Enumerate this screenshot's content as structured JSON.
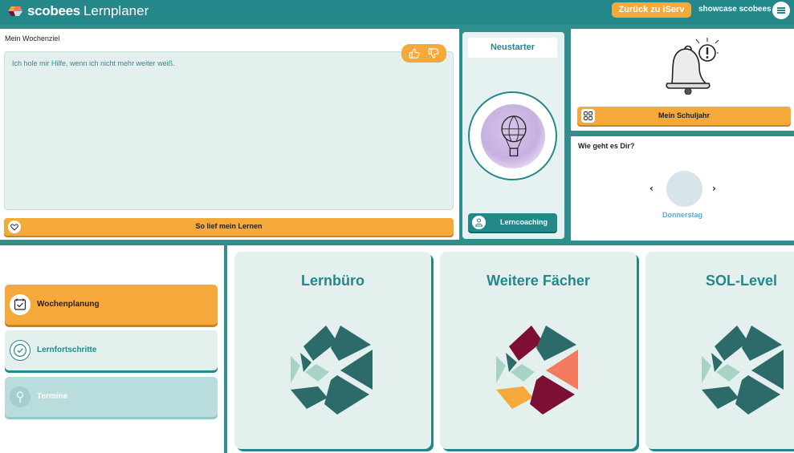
{
  "header": {
    "logo_brand": "scobees",
    "logo_sub": "Lernplaner",
    "back_button": "Zurück zu iServ",
    "user_name": "showcase scobees"
  },
  "goal": {
    "title": "Mein Wochenziel",
    "text": "Ich hole mir Hilfe, wenn ich nicht mehr weiter weiß.",
    "learn_button": "So lief mein Lernen"
  },
  "neustarter": {
    "title": "Neustarter",
    "coach_button": "Lerncoaching"
  },
  "schuljahr": {
    "button": "Mein Schuljahr"
  },
  "mood": {
    "title": "Wie geht es Dir?",
    "prev": "‹",
    "next": "›",
    "day": "Donnerstag"
  },
  "nav": {
    "items": [
      {
        "label": "Wochenplanung",
        "icon": "calendar-check-icon"
      },
      {
        "label": "Lernfortschritte",
        "icon": "check-circle-icon"
      },
      {
        "label": "Termine",
        "icon": "pin-icon"
      }
    ]
  },
  "tiles": [
    {
      "title": "Lernbüro"
    },
    {
      "title": "Weitere Fächer"
    },
    {
      "title": "SOL-Level"
    }
  ],
  "colors": {
    "teal": "#24878a",
    "orange": "#f5a93a",
    "light": "#e3f0ee",
    "dark_teal": "#2d6a6a",
    "maroon": "#7d0f35",
    "coral": "#f27a5e"
  }
}
